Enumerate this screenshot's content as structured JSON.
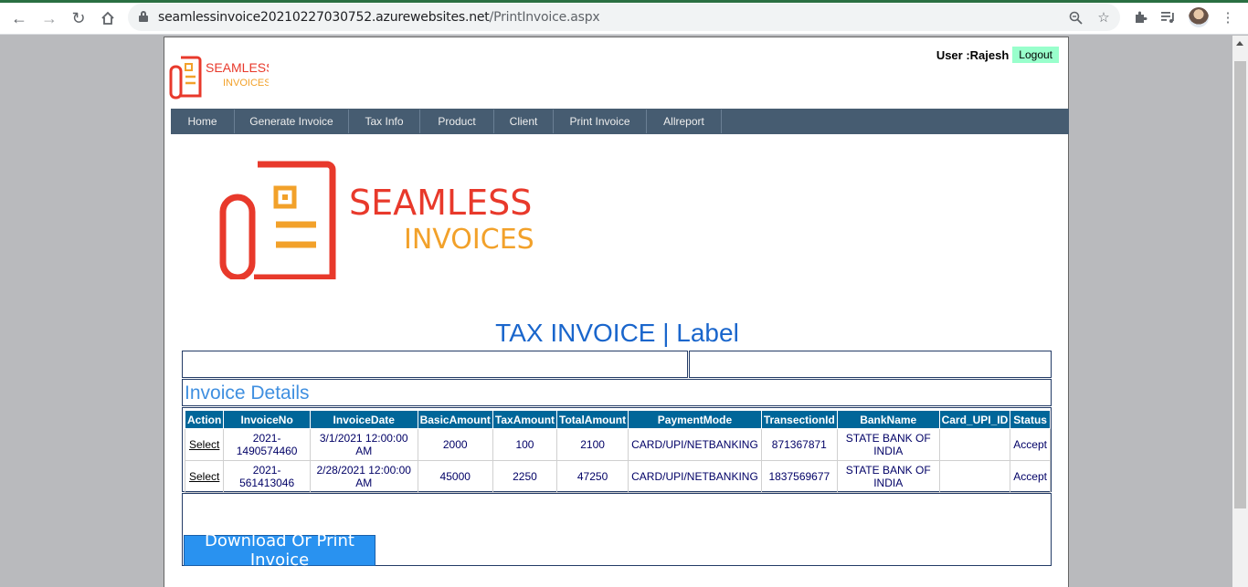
{
  "browser": {
    "url_host": "seamlessinvoice20210227030752.azurewebsites.net",
    "url_path": "/PrintInvoice.aspx"
  },
  "header": {
    "logo_text_line1": "SEAMLESS",
    "logo_text_line2": "INVOICES",
    "user_label": "User :Rajesh",
    "logout_label": "Logout"
  },
  "menu": {
    "items": [
      "Home",
      "Generate Invoice",
      "Tax Info",
      "Product",
      "Client",
      "Print Invoice",
      "Allreport"
    ]
  },
  "main": {
    "logo_line1": "SEAMLESS",
    "logo_line2": "INVOICES",
    "title": "TAX INVOICE | Label",
    "section_title": "Invoice Details",
    "download_label": "Download Or Print Invoice"
  },
  "grid": {
    "headers": [
      "Action",
      "InvoiceNo",
      "InvoiceDate",
      "BasicAmount",
      "TaxAmount",
      "TotalAmount",
      "PaymentMode",
      "TransectionId",
      "BankName",
      "Card_UPI_ID",
      "Status"
    ],
    "rows": [
      [
        "Select",
        "2021-1490574460",
        "3/1/2021 12:00:00 AM",
        "2000",
        "100",
        "2100",
        "CARD/UPI/NETBANKING",
        "871367871",
        "STATE BANK OF INDIA",
        "",
        "Accept"
      ],
      [
        "Select",
        "2021-561413046",
        "2/28/2021 12:00:00 AM",
        "45000",
        "2250",
        "47250",
        "CARD/UPI/NETBANKING",
        "1837569677",
        "STATE BANK OF INDIA",
        "",
        "Accept"
      ]
    ]
  },
  "colors": {
    "menu_bg": "#465c71",
    "grid_header": "#006699",
    "logo_red": "#e8392b",
    "logo_orange": "#f2a12a",
    "title_blue": "#1a66cc",
    "button_blue": "#2992f0",
    "logout_green": "#99ffcc"
  }
}
